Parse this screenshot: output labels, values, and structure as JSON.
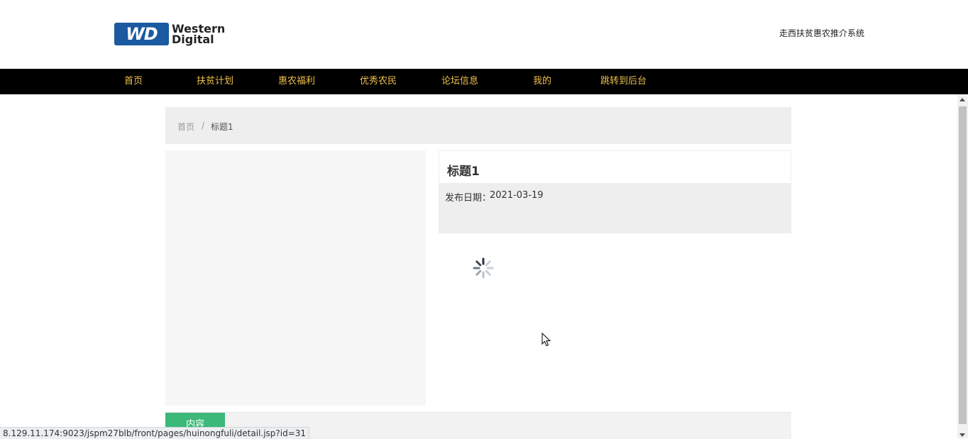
{
  "header": {
    "logo": {
      "badge": "WD",
      "line1": "Western",
      "line2": "Digital"
    },
    "site_name": "走西扶贫惠农推介系统"
  },
  "nav": {
    "items": [
      {
        "label": "首页"
      },
      {
        "label": "扶贫计划"
      },
      {
        "label": "惠农福利"
      },
      {
        "label": "优秀农民"
      },
      {
        "label": "论坛信息"
      },
      {
        "label": "我的"
      },
      {
        "label": "跳转到后台"
      }
    ]
  },
  "breadcrumb": {
    "home": "首页",
    "separator": "/",
    "current": "标题1"
  },
  "detail": {
    "title": "标题1",
    "date_label": "发布日期：",
    "date_value": "2021-03-19"
  },
  "tabs": {
    "content_label": "内容"
  },
  "status_bar": {
    "url": "8.129.11.174:9023/jspm27blb/front/pages/huinongfuli/detail.jsp?id=31"
  },
  "colors": {
    "nav_bg": "#000000",
    "nav_text": "#f0c14b",
    "tab_active": "#3cb878",
    "logo_blue": "#1a5aa0"
  }
}
